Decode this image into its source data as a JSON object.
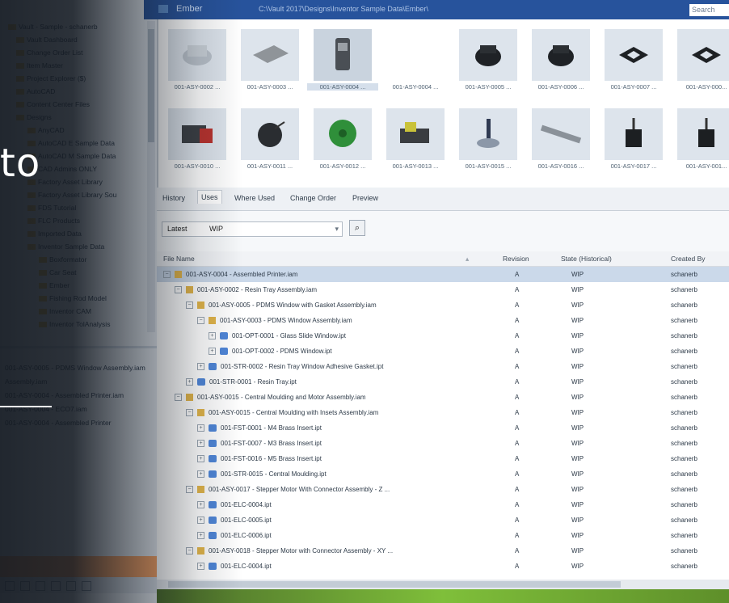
{
  "titlebar": {
    "app_name": "Ember",
    "path": "C:\\Vault 2017\\Designs\\Inventor Sample Data\\Ember\\",
    "search_placeholder": "Search"
  },
  "left_pane": {
    "items": [
      {
        "label": "Vault - Sample - schanerb"
      },
      {
        "label": "Vault Dashboard"
      },
      {
        "label": "Change Order List"
      },
      {
        "label": "Item Master"
      },
      {
        "label": "Project Explorer ($)"
      },
      {
        "label": "AutoCAD"
      },
      {
        "label": "Content Center Files"
      },
      {
        "label": "Designs"
      },
      {
        "label": "AnyCAD"
      },
      {
        "label": "AutoCAD E Sample Data"
      },
      {
        "label": "AutoCAD M Sample Data"
      },
      {
        "label": "CAD Admins ONLY"
      },
      {
        "label": "Factory Asset Library"
      },
      {
        "label": "Factory Asset Library Sou"
      },
      {
        "label": "FDS Tutorial"
      },
      {
        "label": "FLC Products"
      },
      {
        "label": "Imported Data"
      },
      {
        "label": "Inventor Sample Data"
      },
      {
        "label": "Boxformator"
      },
      {
        "label": "Car Seat"
      },
      {
        "label": "Ember"
      },
      {
        "label": "Fishing Rod Model"
      },
      {
        "label": "Inventor CAM"
      },
      {
        "label": "Inventor TolAnalysis"
      }
    ],
    "recent": [
      {
        "label": "001-ASY-0005 - PDMS Window Assembly.iam"
      },
      {
        "label": "Assembly.iam"
      },
      {
        "label": "001-ASY-0004 - Assembled Printer.iam"
      },
      {
        "label": "001-ASY-0004 - ECO7.iam"
      },
      {
        "label": "001-ASY-0004 - Assembled Printer"
      }
    ]
  },
  "overlay": {
    "text": "to"
  },
  "gallery": {
    "items": [
      {
        "caption": "001-ASY-0002 ...",
        "icon": "tray-part"
      },
      {
        "caption": "001-ASY-0003 ...",
        "icon": "plate-part"
      },
      {
        "caption": "001-ASY-0004 ...",
        "icon": "printer-assembly",
        "selected": true
      },
      {
        "caption": "001-ASY-0004 ...",
        "icon": "blank"
      },
      {
        "caption": "001-ASY-0005 ...",
        "icon": "black-housing"
      },
      {
        "caption": "001-ASY-0006 ...",
        "icon": "black-housing"
      },
      {
        "caption": "001-ASY-0007 ...",
        "icon": "window-frame"
      },
      {
        "caption": "001-ASY-000...",
        "icon": "window-frame"
      },
      {
        "caption": "001-ASY-0010 ...",
        "icon": "motor-red"
      },
      {
        "caption": "001-ASY-0011 ...",
        "icon": "motor-black"
      },
      {
        "caption": "001-ASY-0012 ...",
        "icon": "gear-green"
      },
      {
        "caption": "001-ASY-0013 ...",
        "icon": "assembly-yellow"
      },
      {
        "caption": "001-ASY-0015 ...",
        "icon": "stand-blue"
      },
      {
        "caption": "001-ASY-0016 ...",
        "icon": "chain-grey"
      },
      {
        "caption": "001-ASY-0017 ...",
        "icon": "stepper-motor"
      },
      {
        "caption": "001-ASY-001...",
        "icon": "stepper-motor"
      }
    ]
  },
  "tabs": [
    {
      "label": "History"
    },
    {
      "label": "Uses",
      "active": true
    },
    {
      "label": "Where Used"
    },
    {
      "label": "Change Order"
    },
    {
      "label": "Preview"
    }
  ],
  "filter": {
    "version": "Latest",
    "state": "WIP"
  },
  "table": {
    "columns": {
      "name": "File Name",
      "revision": "Revision",
      "state": "State (Historical)",
      "created_by": "Created By"
    },
    "rows": [
      {
        "name": "001-ASY-0004 - Assembled Printer.iam",
        "rev": "A",
        "state": "WIP",
        "by": "schanerb",
        "indent": 0,
        "kind": "asm",
        "selected": true
      },
      {
        "name": "001-ASY-0002 - Resin Tray Assembly.iam",
        "rev": "A",
        "state": "WIP",
        "by": "schanerb",
        "indent": 1,
        "kind": "asm"
      },
      {
        "name": "001-ASY-0005 - PDMS Window with Gasket Assembly.iam",
        "rev": "A",
        "state": "WIP",
        "by": "schanerb",
        "indent": 2,
        "kind": "asm"
      },
      {
        "name": "001-ASY-0003 - PDMS Window Assembly.iam",
        "rev": "A",
        "state": "WIP",
        "by": "schanerb",
        "indent": 3,
        "kind": "asm"
      },
      {
        "name": "001-OPT-0001 - Glass Slide Window.ipt",
        "rev": "A",
        "state": "WIP",
        "by": "schanerb",
        "indent": 4,
        "kind": "part"
      },
      {
        "name": "001-OPT-0002 - PDMS Window.ipt",
        "rev": "A",
        "state": "WIP",
        "by": "schanerb",
        "indent": 4,
        "kind": "part"
      },
      {
        "name": "001-STR-0002 - Resin Tray Window Adhesive Gasket.ipt",
        "rev": "A",
        "state": "WIP",
        "by": "schanerb",
        "indent": 3,
        "kind": "part"
      },
      {
        "name": "001-STR-0001 - Resin Tray.ipt",
        "rev": "A",
        "state": "WIP",
        "by": "schanerb",
        "indent": 2,
        "kind": "part"
      },
      {
        "name": "001-ASY-0015 - Central Moulding and Motor Assembly.iam",
        "rev": "A",
        "state": "WIP",
        "by": "schanerb",
        "indent": 1,
        "kind": "asm"
      },
      {
        "name": "001-ASY-0015 - Central Moulding with Insets Assembly.iam",
        "rev": "A",
        "state": "WIP",
        "by": "schanerb",
        "indent": 2,
        "kind": "asm"
      },
      {
        "name": "001-FST-0001 - M4 Brass Insert.ipt",
        "rev": "A",
        "state": "WIP",
        "by": "schanerb",
        "indent": 3,
        "kind": "part"
      },
      {
        "name": "001-FST-0007 - M3 Brass Insert.ipt",
        "rev": "A",
        "state": "WIP",
        "by": "schanerb",
        "indent": 3,
        "kind": "part"
      },
      {
        "name": "001-FST-0016 - M5 Brass Insert.ipt",
        "rev": "A",
        "state": "WIP",
        "by": "schanerb",
        "indent": 3,
        "kind": "part"
      },
      {
        "name": "001-STR-0015 - Central Moulding.ipt",
        "rev": "A",
        "state": "WIP",
        "by": "schanerb",
        "indent": 3,
        "kind": "part"
      },
      {
        "name": "001-ASY-0017 - Stepper Motor With Connector Assembly - Z ...",
        "rev": "A",
        "state": "WIP",
        "by": "schanerb",
        "indent": 2,
        "kind": "asm"
      },
      {
        "name": "001-ELC-0004.ipt",
        "rev": "A",
        "state": "WIP",
        "by": "schanerb",
        "indent": 3,
        "kind": "part"
      },
      {
        "name": "001-ELC-0005.ipt",
        "rev": "A",
        "state": "WIP",
        "by": "schanerb",
        "indent": 3,
        "kind": "part"
      },
      {
        "name": "001-ELC-0006.ipt",
        "rev": "A",
        "state": "WIP",
        "by": "schanerb",
        "indent": 3,
        "kind": "part"
      },
      {
        "name": "001-ASY-0018 - Stepper Motor with Connector Assembly - XY ...",
        "rev": "A",
        "state": "WIP",
        "by": "schanerb",
        "indent": 2,
        "kind": "asm"
      },
      {
        "name": "001-ELC-0004.ipt",
        "rev": "A",
        "state": "WIP",
        "by": "schanerb",
        "indent": 3,
        "kind": "part"
      }
    ]
  },
  "colors": {
    "titlebar": "#27539c",
    "selection": "#cbd9ea",
    "accent_green": "#7fbf3a",
    "orange_band": "#f7a264"
  }
}
